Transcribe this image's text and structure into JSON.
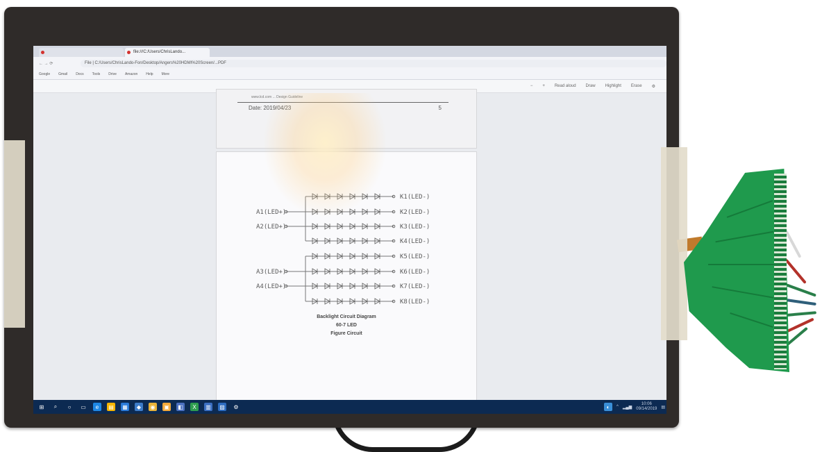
{
  "browser": {
    "tabs": [
      {
        "label": "",
        "active": false
      },
      {
        "label": "file:///C:/Users/ChrisLando...",
        "active": true
      }
    ],
    "url": "File | C:/Users/ChrisLando-Fon/Desktop/Angers%20HDMI%20Screen/...PDF",
    "bookmarks": [
      "Google",
      "Gmail",
      "Docs",
      "Tools",
      "Drive",
      "Amazon",
      "Help",
      "More"
    ],
    "pdf_toolbar": [
      "Read aloud",
      "Draw",
      "Highlight",
      "Erase"
    ]
  },
  "pdf": {
    "page1": {
      "small_text": "www.lcd.com  ...  Design Guideline",
      "date": "Date: 2019/04/23",
      "page_number": "5"
    },
    "schematic": {
      "anodes": [
        "A1(LED+)",
        "A2(LED+)",
        "A3(LED+)",
        "A4(LED+)"
      ],
      "cathodes": [
        "K1(LED-)",
        "K2(LED-)",
        "K3(LED-)",
        "K4(LED-)",
        "K5(LED-)",
        "K6(LED-)",
        "K7(LED-)",
        "K8(LED-)"
      ]
    },
    "caption": {
      "line1": "Backlight Circuit Diagram",
      "line2": "60-7      LED",
      "line3": "Figure       Circuit"
    }
  },
  "taskbar": {
    "clock": "10:06",
    "date": "09/14/2019"
  },
  "colors": {
    "bezel": "#2f2b29",
    "pcb": "#1f9a4d",
    "taskbar": "#0c2a52",
    "tape": "#e3dccb"
  }
}
